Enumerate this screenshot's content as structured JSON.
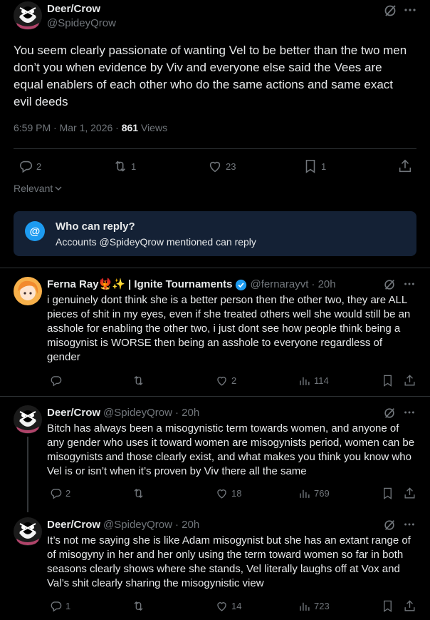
{
  "main_tweet": {
    "author_name": "Deer/Crow",
    "author_handle": "@SpideyQrow",
    "text": "You seem clearly passionate of wanting Vel to be better than the two men don’t you when evidence by Viv and everyone else said the Vees are equal enablers of each other who do the same actions and same exact evil deeds",
    "timestamp": "6:59 PM · Mar 1, 2026 · ",
    "views_count": "861",
    "views_label": " Views",
    "replies": "2",
    "reposts": "1",
    "likes": "23",
    "bookmarks": "1",
    "sort_label": "Relevant"
  },
  "reply_notice": {
    "title": "Who can reply?",
    "body": "Accounts @SpideyQrow mentioned can reply",
    "accent": "#1d9bf0",
    "bg": "#142135"
  },
  "replies": [
    {
      "author_name": "Ferna Ray🐦‍🔥✨ | Ignite Tournaments",
      "author_handle": "@fernarayvt",
      "time": "· 20h",
      "text": "i genuinely dont think she is a better person then the other two, they are ALL pieces of shit in my eyes, even if she treated others well she would still be an asshole for enabling the other two, i just dont see how people think being a misogynist is WORSE then being an asshole to everyone regardless of gender",
      "replies": "",
      "reposts": "",
      "likes": "2",
      "views": "114",
      "verified": true
    },
    {
      "author_name": "Deer/Crow",
      "author_handle": "@SpideyQrow",
      "time": "· 20h",
      "text": "Bitch has always been a misogynistic term towards women, and anyone of any gender who uses it toward women are misogynists period, women can be misogynists and those clearly exist, and what makes you think you know who Vel is or isn’t when it’s proven by Viv there all the same",
      "replies": "2",
      "reposts": "",
      "likes": "18",
      "views": "769"
    },
    {
      "author_name": "Deer/Crow",
      "author_handle": "@SpideyQrow",
      "time": "· 20h",
      "text": "It’s not me saying she is like Adam misogynist but she has an extant range of of misogyny in her and her only using the term toward women so far in both seasons clearly shows where she stands, Vel literally laughs off at Vox and Val’s shit clearly sharing the misogynistic view",
      "replies": "1",
      "reposts": "",
      "likes": "14",
      "views": "723"
    }
  ],
  "icons": {
    "reply": "reply-icon",
    "repost": "repost-icon",
    "like": "like-icon",
    "bookmark": "bookmark-icon",
    "share": "share-icon",
    "views": "views-icon",
    "grok": "grok-icon",
    "more": "more-icon",
    "verified": "verified-badge-icon",
    "at": "at-icon"
  }
}
